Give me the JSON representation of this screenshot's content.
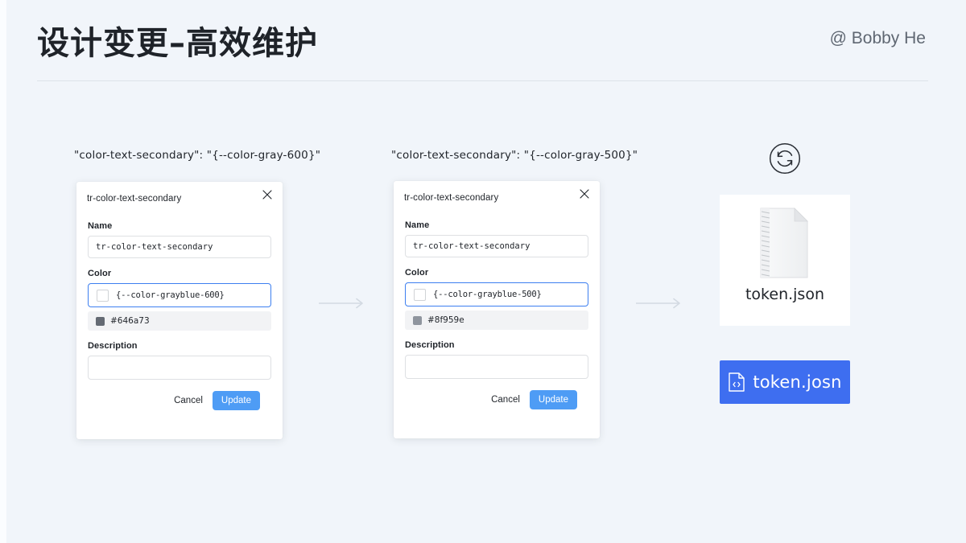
{
  "header": {
    "title": "设计变更–高效维护",
    "author": "@ Bobby He"
  },
  "captions": {
    "before": "\"color-text-secondary\":  \"{--color-gray-600}\"",
    "after": "\"color-text-secondary\":  \"{--color-gray-500}\""
  },
  "cards": [
    {
      "title": "tr-color-text-secondary",
      "close_icon": "close-icon",
      "name_label": "Name",
      "name_value": "tr-color-text-secondary",
      "color_label": "Color",
      "color_value": "{--color-grayblue-600}",
      "hex_value": "#646a73",
      "hex_swatch_color": "#646a73",
      "description_label": "Description",
      "description_value": "",
      "cancel_label": "Cancel",
      "update_label": "Update"
    },
    {
      "title": "tr-color-text-secondary",
      "close_icon": "close-icon",
      "name_label": "Name",
      "name_value": "tr-color-text-secondary",
      "color_label": "Color",
      "color_value": "{--color-grayblue-500}",
      "hex_value": "#8f959e",
      "hex_swatch_color": "#8f959e",
      "description_label": "Description",
      "description_value": "",
      "cancel_label": "Cancel",
      "update_label": "Update"
    }
  ],
  "arrows": {
    "icon": "arrow-right-icon"
  },
  "sync": {
    "icon": "sync-refresh-icon"
  },
  "file_card": {
    "icon": "json-file-icon",
    "name": "token.json"
  },
  "token_button": {
    "icon": "code-file-icon",
    "label": "token.josn"
  },
  "colors": {
    "background": "#f1f5fa",
    "accent_blue": "#3e6ef0",
    "update_blue": "#4e9cf5",
    "focus_border": "#3d7ff0",
    "text_primary": "#1f2329",
    "text_secondary": "#5f6772"
  }
}
